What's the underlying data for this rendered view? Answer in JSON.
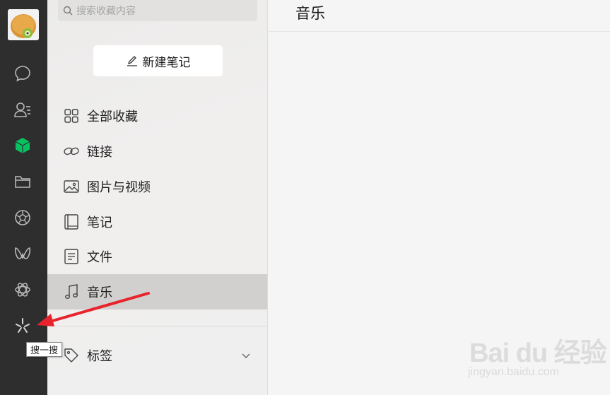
{
  "rail": {
    "icons": [
      "chat-icon",
      "contacts-icon",
      "favorites-cube-icon",
      "folder-icon",
      "moments-icon",
      "channels-icon",
      "mini-program-icon",
      "search-sparkle-icon"
    ],
    "active_color": "#07c160",
    "tooltip": "搜一搜"
  },
  "search": {
    "placeholder": "搜索收藏内容"
  },
  "new_note": {
    "label": "新建笔记"
  },
  "nav": {
    "items": [
      {
        "label": "全部收藏",
        "icon": "grid-icon"
      },
      {
        "label": "链接",
        "icon": "link-icon"
      },
      {
        "label": "图片与视频",
        "icon": "image-icon"
      },
      {
        "label": "笔记",
        "icon": "notebook-icon"
      },
      {
        "label": "文件",
        "icon": "file-icon"
      },
      {
        "label": "音乐",
        "icon": "music-icon",
        "active": true
      }
    ],
    "tags_label": "标签"
  },
  "main": {
    "title": "音乐"
  },
  "watermark": {
    "brand": "Bai du 经验",
    "url": "jingyan.baidu.com"
  },
  "annotation": {
    "arrow_color": "#e8232d"
  }
}
